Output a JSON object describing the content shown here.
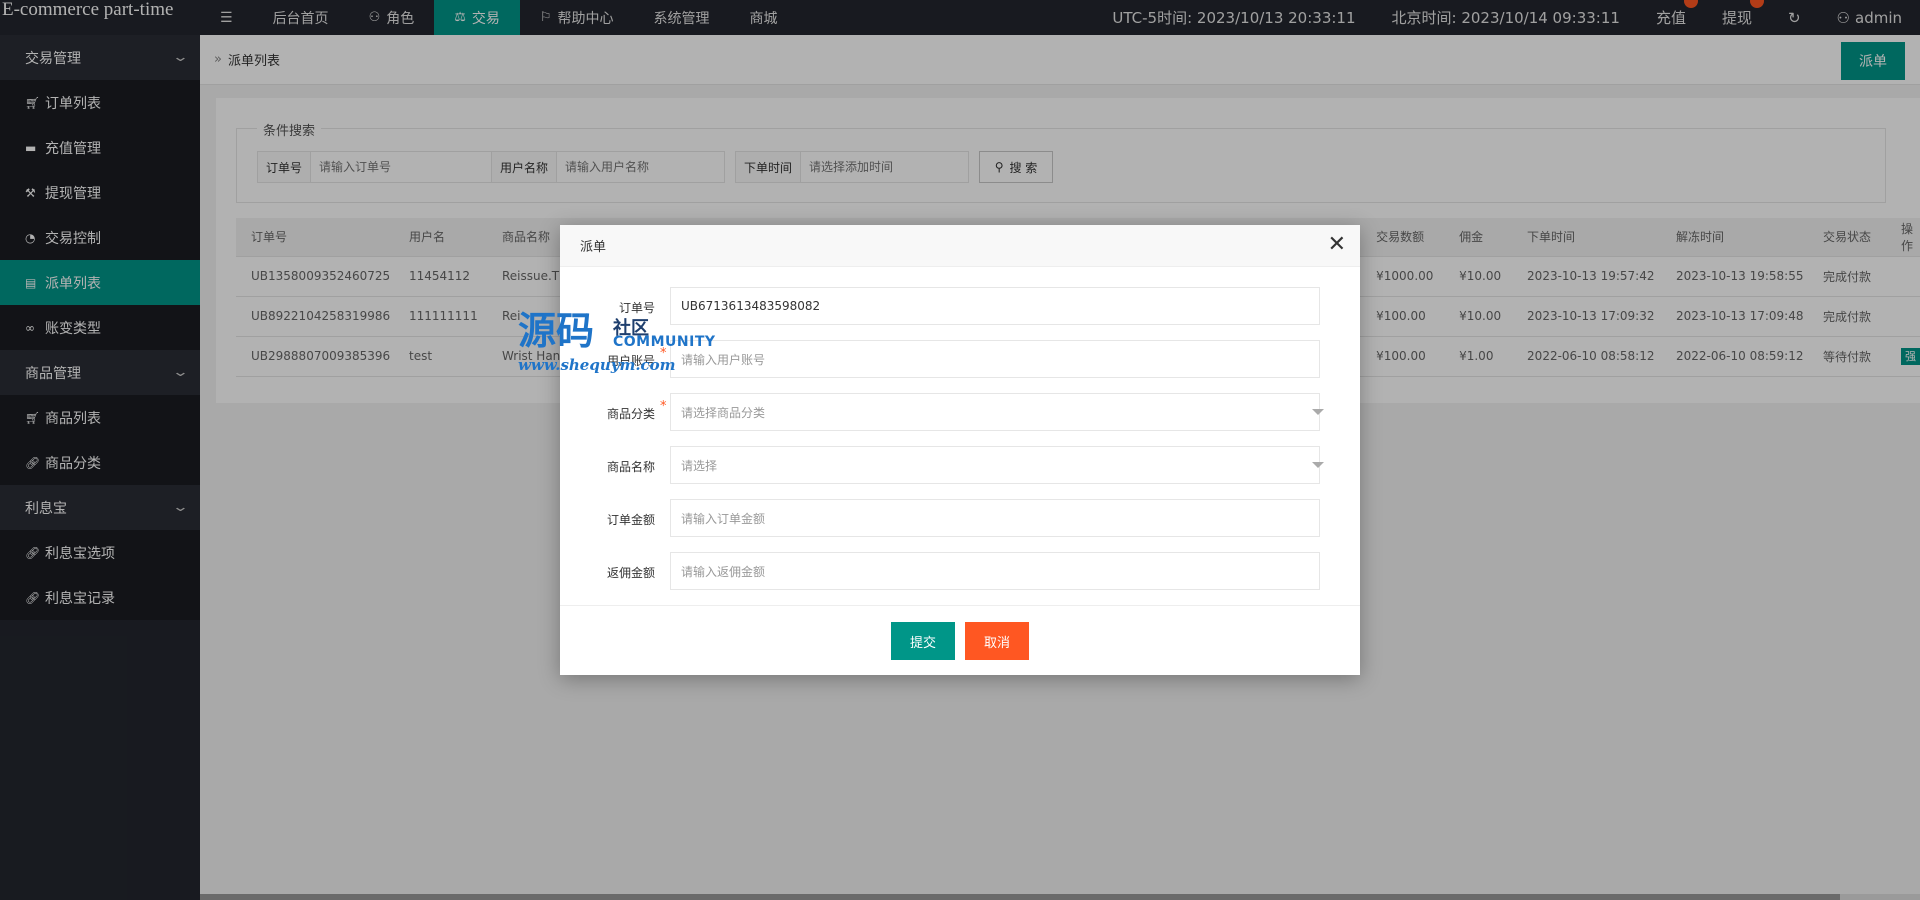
{
  "app": {
    "title": "E-commerce part-time"
  },
  "topnav": [
    {
      "icon": "menu-icon",
      "label": ""
    },
    {
      "label": "后台首页"
    },
    {
      "icon": "user-icon",
      "label": "角色"
    },
    {
      "icon": "balance-icon",
      "label": "交易"
    },
    {
      "icon": "flag-icon",
      "label": "帮助中心"
    },
    {
      "label": "系统管理"
    },
    {
      "label": "商城"
    }
  ],
  "topright": {
    "utc_time": "UTC-5时间: 2023/10/13 20:33:11",
    "beijing_time": "北京时间: 2023/10/14 09:33:11",
    "recharge": "充值",
    "withdraw": "提现",
    "user": "admin"
  },
  "sidebar": {
    "groups": [
      {
        "label": "交易管理",
        "items": [
          {
            "icon": "cart-icon",
            "label": "订单列表"
          },
          {
            "icon": "card-icon",
            "label": "充值管理"
          },
          {
            "icon": "gavel-icon",
            "label": "提现管理"
          },
          {
            "icon": "gauge-icon",
            "label": "交易控制"
          },
          {
            "icon": "book-icon",
            "label": "派单列表"
          },
          {
            "icon": "link-icon",
            "label": "账变类型"
          }
        ]
      },
      {
        "label": "商品管理",
        "items": [
          {
            "icon": "cart-icon",
            "label": "商品列表"
          },
          {
            "icon": "link-icon",
            "label": "商品分类"
          }
        ]
      },
      {
        "label": "利息宝",
        "items": [
          {
            "icon": "link-icon",
            "label": "利息宝选项"
          },
          {
            "icon": "link-icon",
            "label": "利息宝记录"
          }
        ]
      }
    ]
  },
  "breadcrumb": "派单列表",
  "dispatch_button": "派单",
  "search": {
    "legend": "条件搜索",
    "fields": [
      {
        "label": "订单号",
        "placeholder": "请输入订单号"
      },
      {
        "label": "用户名称",
        "placeholder": "请输入用户名称"
      },
      {
        "label": "下单时间",
        "placeholder": "请选择添加时间"
      }
    ],
    "button": "搜 索"
  },
  "table": {
    "headers": [
      "订单号",
      "用户名",
      "商品名称",
      "交易数额",
      "佣金",
      "下单时间",
      "解冻时间",
      "交易状态",
      "操作"
    ],
    "rows": [
      [
        "UB1358009352460725",
        "11454112",
        "Reissue.Th",
        "¥1000.00",
        "¥10.00",
        "2023-10-13 19:57:42",
        "2023-10-13 19:58:55",
        "完成付款",
        ""
      ],
      [
        "UB8922104258319986",
        "111111111",
        "Rei",
        "¥100.00",
        "¥10.00",
        "2023-10-13 17:09:32",
        "2023-10-13 17:09:48",
        "完成付款",
        ""
      ],
      [
        "UB2988807009385396",
        "test",
        "Wrist Han",
        "¥100.00",
        "¥1.00",
        "2022-06-10 08:58:12",
        "2022-06-10 08:59:12",
        "等待付款",
        "强"
      ]
    ]
  },
  "modal": {
    "title": "派单",
    "fields": [
      {
        "label": "订单号",
        "value": "UB6713613483598082",
        "placeholder": "",
        "required": false,
        "select": false
      },
      {
        "label": "用户账号",
        "value": "",
        "placeholder": "请输入用户账号",
        "required": true,
        "select": false
      },
      {
        "label": "商品分类",
        "value": "",
        "placeholder": "请选择商品分类",
        "required": true,
        "select": true
      },
      {
        "label": "商品名称",
        "value": "",
        "placeholder": "请选择",
        "required": false,
        "select": true
      },
      {
        "label": "订单金额",
        "value": "",
        "placeholder": "请输入订单金额",
        "required": false,
        "select": false
      },
      {
        "label": "返佣金额",
        "value": "",
        "placeholder": "请输入返佣金额",
        "required": false,
        "select": false
      }
    ],
    "submit": "提交",
    "cancel": "取消"
  },
  "watermark": {
    "big": "源码",
    "small": "社区",
    "community": "COMMUNITY",
    "url": "www.shequym.com"
  },
  "colors": {
    "primary": "#009688",
    "danger": "#ff5722",
    "dark": "#23262e"
  }
}
